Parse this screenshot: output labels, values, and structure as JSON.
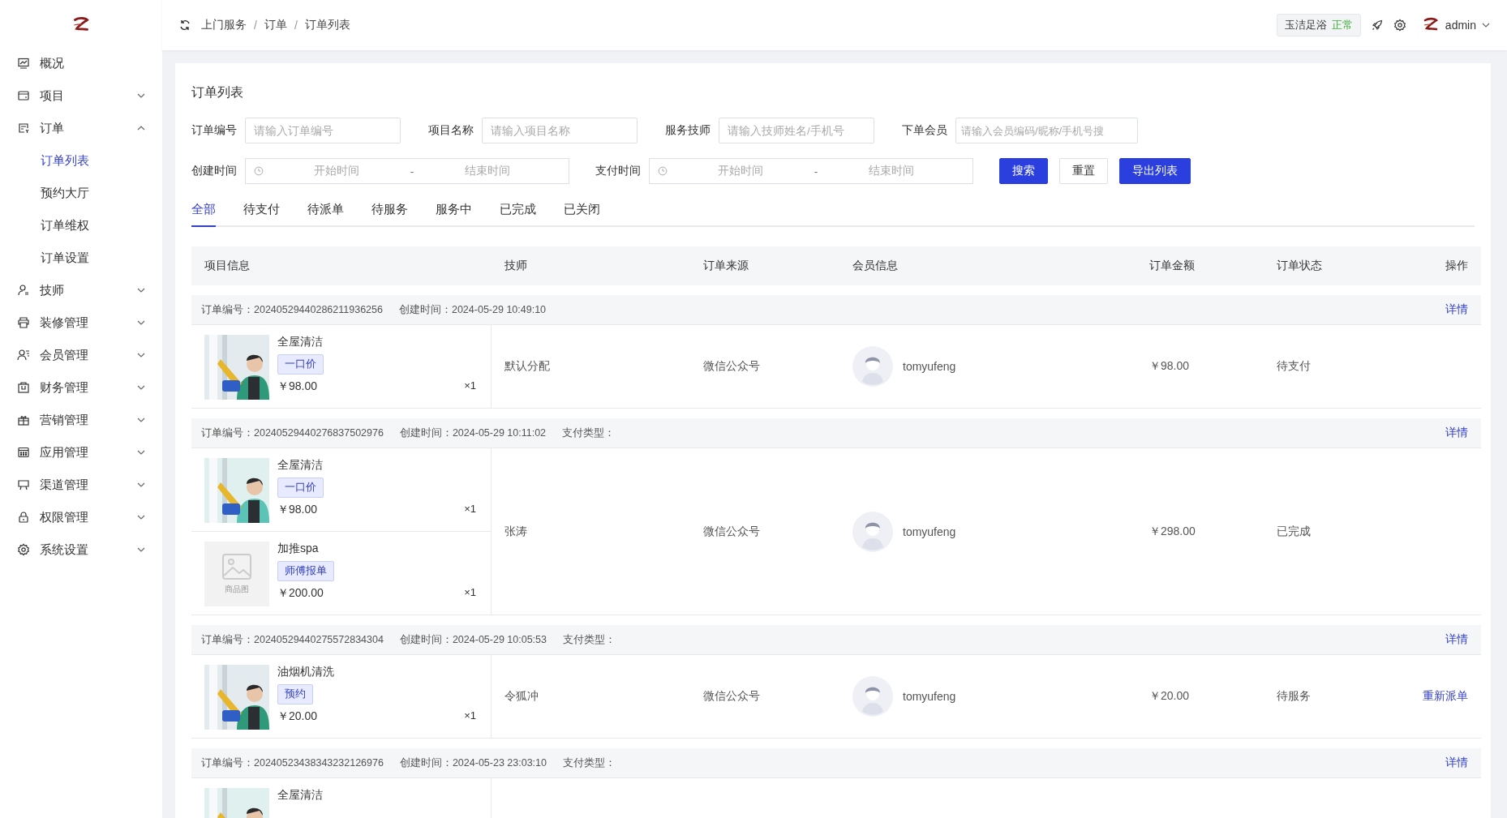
{
  "sidebar": {
    "items": [
      {
        "label": "概况",
        "kind": "link"
      },
      {
        "label": "项目",
        "kind": "group",
        "expanded": false
      },
      {
        "label": "订单",
        "kind": "group",
        "expanded": true,
        "children": [
          {
            "label": "订单列表",
            "selected": true
          },
          {
            "label": "预约大厅",
            "selected": false
          },
          {
            "label": "订单维权",
            "selected": false
          },
          {
            "label": "订单设置",
            "selected": false
          }
        ]
      },
      {
        "label": "技师",
        "kind": "group",
        "expanded": false
      },
      {
        "label": "装修管理",
        "kind": "group",
        "expanded": false
      },
      {
        "label": "会员管理",
        "kind": "group",
        "expanded": false
      },
      {
        "label": "财务管理",
        "kind": "group",
        "expanded": false
      },
      {
        "label": "营销管理",
        "kind": "group",
        "expanded": false
      },
      {
        "label": "应用管理",
        "kind": "group",
        "expanded": false
      },
      {
        "label": "渠道管理",
        "kind": "group",
        "expanded": false
      },
      {
        "label": "权限管理",
        "kind": "group",
        "expanded": false
      },
      {
        "label": "系统设置",
        "kind": "group",
        "expanded": false
      }
    ]
  },
  "header": {
    "breadcrumb": [
      "上门服务",
      "订单",
      "订单列表"
    ],
    "breadcrumb_separator": "/",
    "store": {
      "name": "玉洁足浴",
      "status": "正常"
    },
    "user": "admin"
  },
  "page": {
    "title": "订单列表",
    "filters": [
      {
        "label": "订单编号",
        "placeholder": "请输入订单编号"
      },
      {
        "label": "项目名称",
        "placeholder": "请输入项目名称"
      },
      {
        "label": "服务技师",
        "placeholder": "请输入技师姓名/手机号"
      },
      {
        "label": "下单会员",
        "placeholder": "请输入会员编码/昵称/手机号搜"
      }
    ],
    "date_ranges": [
      {
        "label": "创建时间",
        "start": "开始时间",
        "separator": "-",
        "end": "结束时间"
      },
      {
        "label": "支付时间",
        "start": "开始时间",
        "separator": "-",
        "end": "结束时间"
      }
    ],
    "buttons": [
      {
        "label": "搜索",
        "kind": "primary"
      },
      {
        "label": "重置",
        "kind": "default"
      },
      {
        "label": "导出列表",
        "kind": "primary"
      }
    ],
    "tabs": [
      {
        "label": "全部",
        "selected": true
      },
      {
        "label": "待支付",
        "selected": false
      },
      {
        "label": "待派单",
        "selected": false
      },
      {
        "label": "待服务",
        "selected": false
      },
      {
        "label": "服务中",
        "selected": false
      },
      {
        "label": "已完成",
        "selected": false
      },
      {
        "label": "已关闭",
        "selected": false
      }
    ]
  },
  "table": {
    "columns": [
      "项目信息",
      "技师",
      "订单来源",
      "会员信息",
      "订单金额",
      "订单状态",
      "操作"
    ],
    "orders": [
      {
        "number": "订单编号：20240529440286211936256",
        "created": "创建时间：2024-05-29 10:49:10",
        "action": "详情",
        "items": [
          {
            "name": "全屋清洁",
            "tag": "一口价",
            "price": "￥98.00",
            "qty": "×1"
          }
        ],
        "technician": "默认分配",
        "source": "微信公众号",
        "member": "tomyufeng",
        "amount": "￥98.00",
        "status": "待支付"
      },
      {
        "number": "订单编号：20240529440276837502976",
        "created": "创建时间：2024-05-29 10:11:02",
        "pay_type": "支付类型：",
        "action": "详情",
        "items": [
          {
            "name": "全屋清洁",
            "tag": "一口价",
            "price": "￥98.00",
            "qty": "×1"
          },
          {
            "image": {
              "kind": "placeholder",
              "caption": "商品图"
            },
            "name": "加推spa",
            "tag": "师傅报单",
            "price": "￥200.00",
            "qty": "×1"
          }
        ],
        "technician": "张涛",
        "source": "微信公众号",
        "member": "tomyufeng",
        "amount": "￥298.00",
        "status": "已完成"
      },
      {
        "number": "订单编号：20240529440275572834304",
        "created": "创建时间：2024-05-29 10:05:53",
        "pay_type": "支付类型：",
        "action": "详情",
        "items": [
          {
            "name": "油烟机清洗",
            "tag": "预约",
            "price": "￥20.00",
            "qty": "×1"
          }
        ],
        "technician": "令狐冲",
        "source": "微信公众号",
        "member": "tomyufeng",
        "amount": "￥20.00",
        "status": "待服务",
        "row_action": "重新派单"
      },
      {
        "number": "订单编号：20240523438343232126976",
        "created": "创建时间：2024-05-23 23:03:10",
        "pay_type": "支付类型：",
        "action": "详情",
        "items": [
          {
            "name": "全屋清洁"
          }
        ]
      }
    ]
  }
}
